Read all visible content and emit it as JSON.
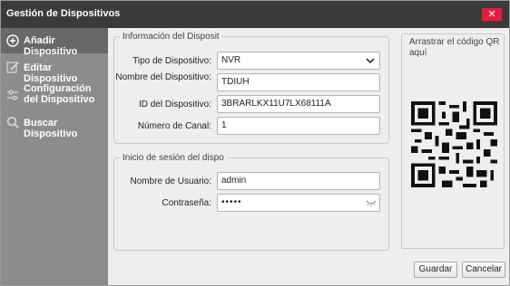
{
  "window": {
    "title": "Gestión de Dispositivos",
    "close_glyph": "✕"
  },
  "sidebar": {
    "items": [
      {
        "label": "Añadir Dispositivo",
        "icon": "add-circle-icon",
        "active": true
      },
      {
        "label": "Editar Dispositivo",
        "icon": "edit-icon"
      },
      {
        "label": "Configuración del Dispositivo",
        "icon": "sliders-icon"
      },
      {
        "label": "Buscar Dispositivo",
        "icon": "search-icon"
      }
    ]
  },
  "device_info": {
    "legend": "Información del Disposit",
    "type_label": "Tipo de Dispositivo:",
    "type_value": "NVR",
    "name_label": "Nombre del Dispositivo:",
    "name_value": "TDIUH",
    "id_label": "ID del Dispositivo:",
    "id_value": "3BRARLKX11U7LX68111A",
    "channel_label": "Número de Canal:",
    "channel_value": "1"
  },
  "login": {
    "legend": "Inicio de sesión del dispo",
    "user_label": "Nombre de Usuario:",
    "user_value": "admin",
    "password_label": "Contraseña:",
    "password_value": "•••••"
  },
  "qr": {
    "caption": "Arrastrar el código QR aquí"
  },
  "buttons": {
    "save": "Guardar",
    "cancel": "Cancelar"
  },
  "colors": {
    "titlebar": "#3b3b3b",
    "close": "#e0213c",
    "sidebar": "#8c8c8c",
    "sidebar_active": "#686868"
  }
}
